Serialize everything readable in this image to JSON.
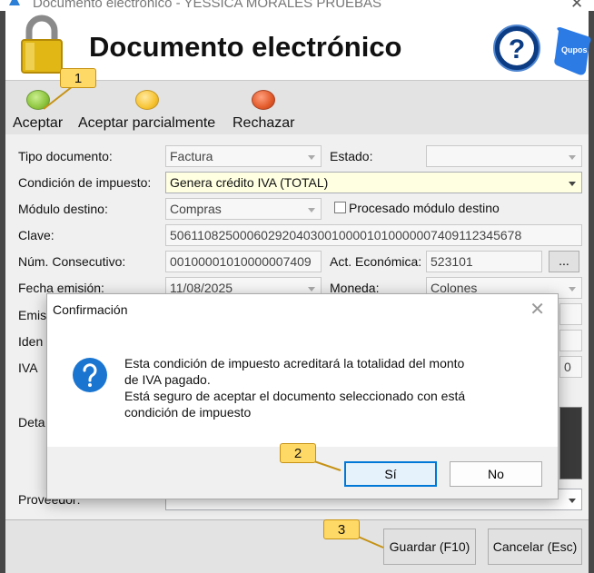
{
  "window": {
    "title": "Documento electrónico - YESSICA MORALES PRUEBAS",
    "header_title": "Documento electrónico",
    "help_glyph": "?",
    "logo_text": "Qupos"
  },
  "toolbar": {
    "accept_label": "Aceptar",
    "partial_label": "Aceptar parcialmente",
    "reject_label": "Rechazar"
  },
  "form": {
    "doc_type_label": "Tipo documento:",
    "doc_type_value": "Factura",
    "status_label": "Estado:",
    "status_value": "",
    "tax_condition_label": "Condición de impuesto:",
    "tax_condition_value": "Genera crédito IVA (TOTAL)",
    "target_module_label": "Módulo destino:",
    "target_module_value": "Compras",
    "processed_label": "Procesado módulo destino",
    "key_label": "Clave:",
    "key_value": "50611082500060292040300100001010000007409112345678",
    "consecutive_label": "Núm. Consecutivo:",
    "consecutive_value": "00100001010000007409",
    "activity_label": "Act. Económica:",
    "activity_value": "523101",
    "ellipsis": "...",
    "issue_date_label": "Fecha emisión:",
    "issue_date_value": "11/08/2025",
    "currency_label": "Moneda:",
    "currency_value": "Colones",
    "issuer_label_partial": "Emis",
    "id_label_partial": "Iden",
    "vat_label_partial": "IVA",
    "vat_value_partial": "0",
    "detail_label_partial": "Deta",
    "supplier_label_partial": "Proveedor:"
  },
  "footer": {
    "save_label": "Guardar (F10)",
    "cancel_label": "Cancelar (Esc)"
  },
  "dialog": {
    "title": "Confirmación",
    "close_glyph": "✕",
    "message_lines": [
      "Esta condición de impuesto acreditará la totalidad del monto",
      "de IVA pagado.",
      "Está seguro de aceptar el documento seleccionado con está",
      "condición de impuesto"
    ],
    "yes_label": "Sí",
    "no_label": "No"
  },
  "callouts": [
    "1",
    "2",
    "3"
  ],
  "colors": {
    "accent": "#0078d7",
    "callout": "#ffd966",
    "frame": "#474747",
    "highlight_field": "#ffffe1"
  }
}
